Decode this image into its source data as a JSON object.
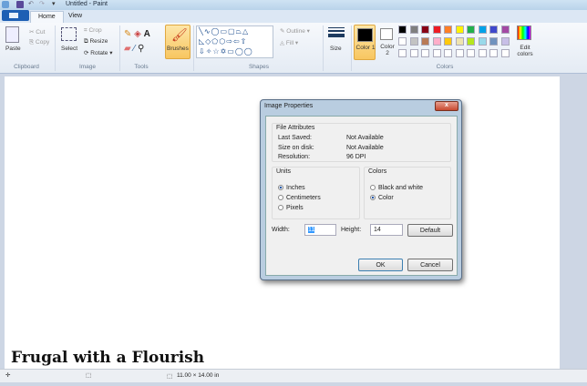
{
  "window": {
    "title": "Untitled - Paint"
  },
  "tabs": [
    {
      "label": "Home"
    },
    {
      "label": "View"
    }
  ],
  "ribbon": {
    "clipboard": {
      "label": "Clipboard",
      "paste": "Paste",
      "cut": "Cut",
      "copy": "Copy"
    },
    "image": {
      "label": "Image",
      "select": "Select",
      "crop": "Crop",
      "resize": "Resize",
      "rotate": "Rotate"
    },
    "tools": {
      "label": "Tools"
    },
    "brushes": "Brushes",
    "shapes": {
      "label": "Shapes",
      "outline": "Outline",
      "fill": "Fill"
    },
    "size": "Size",
    "colors": {
      "label": "Colors",
      "color1": "Color 1",
      "color2": "Color 2",
      "edit": "Edit colors",
      "row1": [
        "#000000",
        "#7f7f7f",
        "#880015",
        "#ed1c24",
        "#ff7f27",
        "#fff200",
        "#22b14c",
        "#00a2e8",
        "#3f48cc",
        "#a349a4"
      ],
      "row2": [
        "#ffffff",
        "#c3c3c3",
        "#b97a57",
        "#ffaec9",
        "#ffc90e",
        "#efe4b0",
        "#b5e61d",
        "#99d9ea",
        "#7092be",
        "#c8bfe7"
      ]
    }
  },
  "canvas": {
    "caption": "Frugal with a Flourish"
  },
  "status": {
    "size": "11.00 × 14.00 in"
  },
  "dialog": {
    "title": "Image Properties",
    "close": "x",
    "file_attributes": {
      "label": "File Attributes",
      "rows": [
        {
          "k": "Last Saved:",
          "v": "Not Available"
        },
        {
          "k": "Size on disk:",
          "v": "Not Available"
        },
        {
          "k": "Resolution:",
          "v": "96 DPI"
        }
      ]
    },
    "units": {
      "label": "Units",
      "options": [
        "Inches",
        "Centimeters",
        "Pixels"
      ],
      "selected": 0
    },
    "colors": {
      "label": "Colors",
      "options": [
        "Black and white",
        "Color"
      ],
      "selected": 1
    },
    "width_label": "Width:",
    "width_value": "11",
    "height_label": "Height:",
    "height_value": "14",
    "default": "Default",
    "ok": "OK",
    "cancel": "Cancel"
  }
}
